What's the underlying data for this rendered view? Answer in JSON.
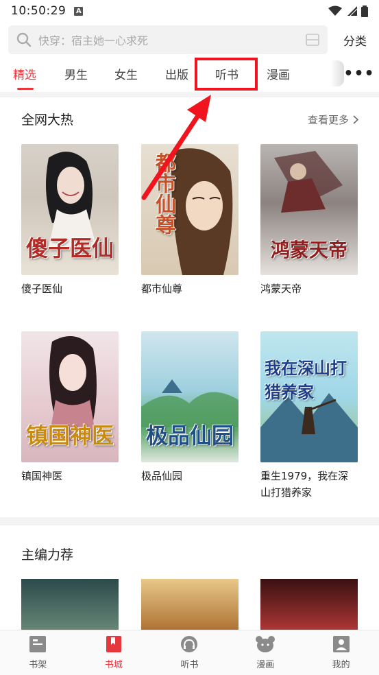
{
  "status_bar": {
    "time": "10:50:29",
    "notification_icon": "A"
  },
  "search": {
    "placeholder": "快穿：宿主她一心求死",
    "category_label": "分类"
  },
  "tabs": [
    {
      "label": "精选",
      "active": true
    },
    {
      "label": "男生"
    },
    {
      "label": "女生"
    },
    {
      "label": "出版"
    },
    {
      "label": "听书",
      "highlighted": true
    },
    {
      "label": "漫画"
    }
  ],
  "hot_section": {
    "title": "全网大热",
    "see_more": "查看更多",
    "books": [
      {
        "title": "傻子医仙",
        "cover_text": "傻子医仙"
      },
      {
        "title": "都市仙尊",
        "cover_text": "都市仙尊"
      },
      {
        "title": "鸿蒙天帝",
        "cover_text": "鸿蒙天帝"
      },
      {
        "title": "镇国神医",
        "cover_text": "镇国神医"
      },
      {
        "title": "极品仙园",
        "cover_text": "极品仙园"
      },
      {
        "title": "重生1979，我在深山打猎养家",
        "cover_text": "我在深山打猎养家"
      }
    ]
  },
  "editor_section": {
    "title": "主编力荐"
  },
  "bottom_nav": [
    {
      "label": "书架",
      "icon": "bookshelf-icon"
    },
    {
      "label": "书城",
      "icon": "bookstore-icon",
      "active": true
    },
    {
      "label": "听书",
      "icon": "headphones-icon"
    },
    {
      "label": "漫画",
      "icon": "bear-icon"
    },
    {
      "label": "我的",
      "icon": "profile-icon"
    }
  ],
  "colors": {
    "accent": "#e6373d",
    "annotation": "#f0141e"
  }
}
